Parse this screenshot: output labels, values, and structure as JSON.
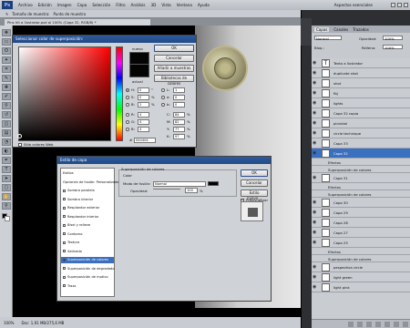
{
  "menubar": {
    "logo": "Ps",
    "items": [
      "Archivo",
      "Edición",
      "Imagen",
      "Capa",
      "Selección",
      "Filtro",
      "Análisis",
      "3D",
      "Vista",
      "Ventana",
      "Ayuda"
    ],
    "workspace": "Aspectos esenciales"
  },
  "options": {
    "size_label": "Tamaño de muestra:",
    "size_value": "Punto de muestra"
  },
  "tab": {
    "title": "Pins hit a Ilustrator.psd al 100% (Capa 32, RGB/8) *"
  },
  "status": {
    "zoom": "100%",
    "doc": "Doc: 1,91 MB/275,6 MB"
  },
  "colorpicker": {
    "title": "Seleccionar color de superposición:",
    "new_label": "nuevo",
    "current_label": "actual",
    "ok": "OK",
    "cancel": "Cancelar",
    "add_swatch": "Añadir a muestras",
    "libraries": "Bibliotecas de colores",
    "hsb": [
      {
        "l": "H:",
        "v": "0",
        "u": "°"
      },
      {
        "l": "S:",
        "v": "0",
        "u": "%"
      },
      {
        "l": "B:",
        "v": "2",
        "u": "%"
      }
    ],
    "rgb": [
      {
        "l": "R:",
        "v": "4"
      },
      {
        "l": "G:",
        "v": "4"
      },
      {
        "l": "B:",
        "v": "4"
      }
    ],
    "lab": [
      {
        "l": "L:",
        "v": "1"
      },
      {
        "l": "a:",
        "v": "0"
      },
      {
        "l": "b:",
        "v": "0"
      }
    ],
    "cmyk": [
      {
        "l": "C:",
        "v": "84",
        "u": "%"
      },
      {
        "l": "M:",
        "v": "82",
        "u": "%"
      },
      {
        "l": "Y:",
        "v": "77",
        "u": "%"
      },
      {
        "l": "K:",
        "v": "97",
        "u": "%"
      }
    ],
    "hex_label": "#",
    "hex": "040404",
    "web_only": "Sólo colores Web"
  },
  "layerstyle": {
    "title": "Estilo de capa",
    "list": [
      {
        "label": "Estilos",
        "chk": false
      },
      {
        "label": "Opciones de fusión: Personalizada",
        "chk": false
      },
      {
        "label": "Sombra paralela",
        "chk": true
      },
      {
        "label": "Sombra interior",
        "chk": true
      },
      {
        "label": "Resplandor exterior",
        "chk": true
      },
      {
        "label": "Resplandor interior",
        "chk": true
      },
      {
        "label": "Bisel y relieve",
        "chk": true
      },
      {
        "label": "Contorno",
        "chk": true
      },
      {
        "label": "Textura",
        "chk": true
      },
      {
        "label": "Satinado",
        "chk": true
      },
      {
        "label": "Superposición de colores",
        "chk": true,
        "active": true
      },
      {
        "label": "Superposición de degradado",
        "chk": true
      },
      {
        "label": "Superposición de motivo",
        "chk": true
      },
      {
        "label": "Trazo",
        "chk": true
      }
    ],
    "group_title": "Superposición de colores",
    "group_sub": "Color",
    "blend_label": "Modo de fusión:",
    "blend_value": "Normal",
    "opacity_label": "Opacidad:",
    "opacity_value": "100",
    "opacity_unit": "%",
    "ok": "OK",
    "cancel": "Cancelar",
    "new_style": "Estilo nuevo...",
    "preview": "Previsualizar"
  },
  "panels": {
    "tabs": [
      "Capas",
      "Canales",
      "Trazados"
    ],
    "blend": "Normal",
    "opacity_label": "Opacidad:",
    "opacity": "100%",
    "lock_label": "Bloq.:",
    "fill_label": "Relleno:",
    "fill": "100%",
    "layers": [
      {
        "name": "Texto a Ilustrator",
        "type": "text"
      },
      {
        "name": "duplicate shot",
        "type": "layer"
      },
      {
        "name": "shot",
        "type": "layer"
      },
      {
        "name": "fbj",
        "type": "layer"
      },
      {
        "name": "lights",
        "type": "layer"
      },
      {
        "name": "Capa 32 copia",
        "type": "layer"
      },
      {
        "name": "pinvidal",
        "type": "layer"
      },
      {
        "name": "circle technique",
        "type": "layer"
      },
      {
        "name": "Capa 33",
        "type": "layer"
      },
      {
        "name": "Capa 32",
        "type": "layer",
        "selected": true
      },
      {
        "name": "Efectos",
        "type": "fx"
      },
      {
        "name": "Superposición de colores",
        "type": "fx"
      },
      {
        "name": "Capa 31",
        "type": "layer"
      },
      {
        "name": "Efectos",
        "type": "fx"
      },
      {
        "name": "Superposición de colores",
        "type": "fx"
      },
      {
        "name": "Capa 30",
        "type": "layer"
      },
      {
        "name": "Capa 29",
        "type": "layer"
      },
      {
        "name": "Capa 28",
        "type": "layer"
      },
      {
        "name": "Capa 27",
        "type": "layer"
      },
      {
        "name": "Capa 25",
        "type": "layer"
      },
      {
        "name": "Efectos",
        "type": "fx"
      },
      {
        "name": "Superposición de colores",
        "type": "fx"
      },
      {
        "name": "pespectiva circle",
        "type": "layer"
      },
      {
        "name": "light green",
        "type": "layer"
      },
      {
        "name": "light pink",
        "type": "layer"
      }
    ]
  }
}
